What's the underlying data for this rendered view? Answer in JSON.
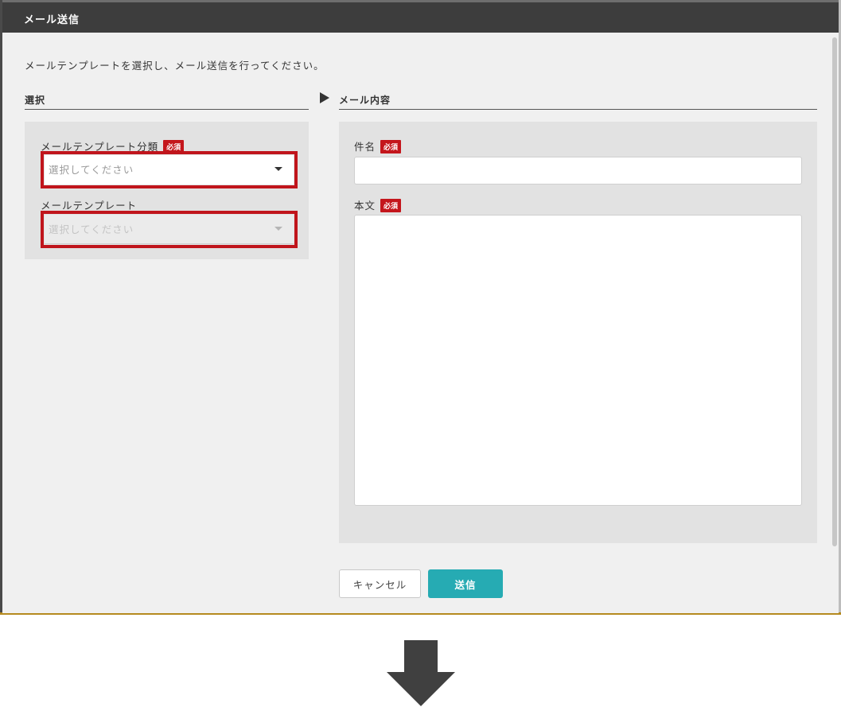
{
  "modal": {
    "title": "メール送信",
    "intro": "メールテンプレートを選択し、メール送信を行ってください。"
  },
  "select_section": {
    "title": "選択",
    "category": {
      "label": "メールテンプレート分類",
      "required": "必須",
      "placeholder": "選択してください"
    },
    "template": {
      "label": "メールテンプレート",
      "placeholder": "選択してください"
    }
  },
  "content_section": {
    "title": "メール内容",
    "subject": {
      "label": "件名",
      "required": "必須",
      "value": ""
    },
    "body": {
      "label": "本文",
      "required": "必須",
      "value": ""
    }
  },
  "footer": {
    "cancel_label": "キャンセル",
    "send_label": "送信"
  },
  "colors": {
    "header_bg": "#3d3d3d",
    "highlight": "#c0151c",
    "required_badge": "#c4161c",
    "send_button": "#26abb3"
  },
  "icons": [
    "dropdown-caret-icon",
    "section-arrow-icon",
    "down-arrow-icon"
  ]
}
